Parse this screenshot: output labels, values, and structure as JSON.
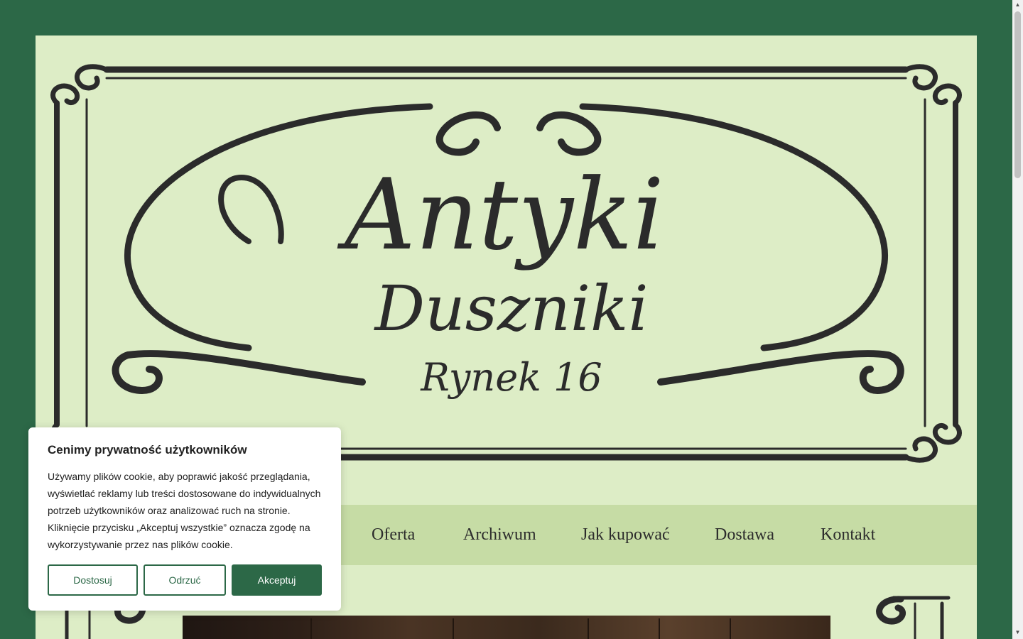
{
  "logo": {
    "line1": "Antyki",
    "line2": "Duszniki",
    "line3": "Rynek 16"
  },
  "nav": {
    "items": [
      "Oferta",
      "Archiwum",
      "Jak kupować",
      "Dostawa",
      "Kontakt"
    ]
  },
  "cookie": {
    "title": "Cenimy prywatność użytkowników",
    "body": "Używamy plików cookie, aby poprawić jakość przeglądania, wyświetlać reklamy lub treści dostosowane do indywidualnych potrzeb użytkowników oraz analizować ruch na stronie. Kliknięcie przycisku „Akceptuj wszystkie” oznacza zgodę na wykorzystywanie przez nas plików cookie.",
    "customize_label": "Dostosuj",
    "reject_label": "Odrzuć",
    "accept_label": "Akceptuj"
  },
  "colors": {
    "background": "#2c6847",
    "page": "#ddedc6",
    "nav": "#c6dca5",
    "ink": "#2b2b2b"
  },
  "icons": {
    "scroll_up": "triangle-up-icon",
    "scroll_down": "triangle-down-icon"
  }
}
